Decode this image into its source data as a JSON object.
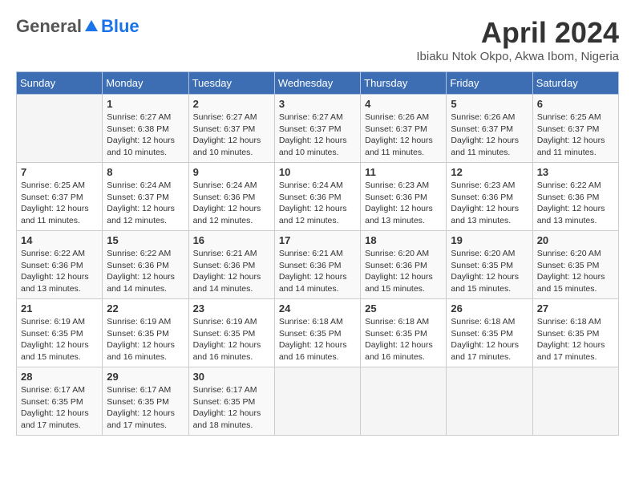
{
  "header": {
    "logo": {
      "general": "General",
      "blue": "Blue"
    },
    "title": "April 2024",
    "location": "Ibiaku Ntok Okpo, Akwa Ibom, Nigeria"
  },
  "calendar": {
    "weekdays": [
      "Sunday",
      "Monday",
      "Tuesday",
      "Wednesday",
      "Thursday",
      "Friday",
      "Saturday"
    ],
    "weeks": [
      [
        {
          "day": "",
          "info": ""
        },
        {
          "day": "1",
          "info": "Sunrise: 6:27 AM\nSunset: 6:38 PM\nDaylight: 12 hours\nand 10 minutes."
        },
        {
          "day": "2",
          "info": "Sunrise: 6:27 AM\nSunset: 6:37 PM\nDaylight: 12 hours\nand 10 minutes."
        },
        {
          "day": "3",
          "info": "Sunrise: 6:27 AM\nSunset: 6:37 PM\nDaylight: 12 hours\nand 10 minutes."
        },
        {
          "day": "4",
          "info": "Sunrise: 6:26 AM\nSunset: 6:37 PM\nDaylight: 12 hours\nand 11 minutes."
        },
        {
          "day": "5",
          "info": "Sunrise: 6:26 AM\nSunset: 6:37 PM\nDaylight: 12 hours\nand 11 minutes."
        },
        {
          "day": "6",
          "info": "Sunrise: 6:25 AM\nSunset: 6:37 PM\nDaylight: 12 hours\nand 11 minutes."
        }
      ],
      [
        {
          "day": "7",
          "info": "Sunrise: 6:25 AM\nSunset: 6:37 PM\nDaylight: 12 hours\nand 11 minutes."
        },
        {
          "day": "8",
          "info": "Sunrise: 6:24 AM\nSunset: 6:37 PM\nDaylight: 12 hours\nand 12 minutes."
        },
        {
          "day": "9",
          "info": "Sunrise: 6:24 AM\nSunset: 6:36 PM\nDaylight: 12 hours\nand 12 minutes."
        },
        {
          "day": "10",
          "info": "Sunrise: 6:24 AM\nSunset: 6:36 PM\nDaylight: 12 hours\nand 12 minutes."
        },
        {
          "day": "11",
          "info": "Sunrise: 6:23 AM\nSunset: 6:36 PM\nDaylight: 12 hours\nand 13 minutes."
        },
        {
          "day": "12",
          "info": "Sunrise: 6:23 AM\nSunset: 6:36 PM\nDaylight: 12 hours\nand 13 minutes."
        },
        {
          "day": "13",
          "info": "Sunrise: 6:22 AM\nSunset: 6:36 PM\nDaylight: 12 hours\nand 13 minutes."
        }
      ],
      [
        {
          "day": "14",
          "info": "Sunrise: 6:22 AM\nSunset: 6:36 PM\nDaylight: 12 hours\nand 13 minutes."
        },
        {
          "day": "15",
          "info": "Sunrise: 6:22 AM\nSunset: 6:36 PM\nDaylight: 12 hours\nand 14 minutes."
        },
        {
          "day": "16",
          "info": "Sunrise: 6:21 AM\nSunset: 6:36 PM\nDaylight: 12 hours\nand 14 minutes."
        },
        {
          "day": "17",
          "info": "Sunrise: 6:21 AM\nSunset: 6:36 PM\nDaylight: 12 hours\nand 14 minutes."
        },
        {
          "day": "18",
          "info": "Sunrise: 6:20 AM\nSunset: 6:36 PM\nDaylight: 12 hours\nand 15 minutes."
        },
        {
          "day": "19",
          "info": "Sunrise: 6:20 AM\nSunset: 6:35 PM\nDaylight: 12 hours\nand 15 minutes."
        },
        {
          "day": "20",
          "info": "Sunrise: 6:20 AM\nSunset: 6:35 PM\nDaylight: 12 hours\nand 15 minutes."
        }
      ],
      [
        {
          "day": "21",
          "info": "Sunrise: 6:19 AM\nSunset: 6:35 PM\nDaylight: 12 hours\nand 15 minutes."
        },
        {
          "day": "22",
          "info": "Sunrise: 6:19 AM\nSunset: 6:35 PM\nDaylight: 12 hours\nand 16 minutes."
        },
        {
          "day": "23",
          "info": "Sunrise: 6:19 AM\nSunset: 6:35 PM\nDaylight: 12 hours\nand 16 minutes."
        },
        {
          "day": "24",
          "info": "Sunrise: 6:18 AM\nSunset: 6:35 PM\nDaylight: 12 hours\nand 16 minutes."
        },
        {
          "day": "25",
          "info": "Sunrise: 6:18 AM\nSunset: 6:35 PM\nDaylight: 12 hours\nand 16 minutes."
        },
        {
          "day": "26",
          "info": "Sunrise: 6:18 AM\nSunset: 6:35 PM\nDaylight: 12 hours\nand 17 minutes."
        },
        {
          "day": "27",
          "info": "Sunrise: 6:18 AM\nSunset: 6:35 PM\nDaylight: 12 hours\nand 17 minutes."
        }
      ],
      [
        {
          "day": "28",
          "info": "Sunrise: 6:17 AM\nSunset: 6:35 PM\nDaylight: 12 hours\nand 17 minutes."
        },
        {
          "day": "29",
          "info": "Sunrise: 6:17 AM\nSunset: 6:35 PM\nDaylight: 12 hours\nand 17 minutes."
        },
        {
          "day": "30",
          "info": "Sunrise: 6:17 AM\nSunset: 6:35 PM\nDaylight: 12 hours\nand 18 minutes."
        },
        {
          "day": "",
          "info": ""
        },
        {
          "day": "",
          "info": ""
        },
        {
          "day": "",
          "info": ""
        },
        {
          "day": "",
          "info": ""
        }
      ]
    ]
  }
}
